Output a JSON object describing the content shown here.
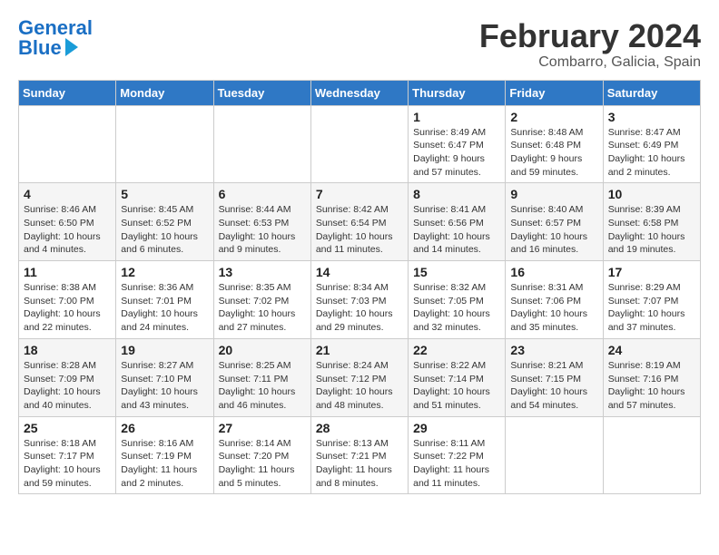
{
  "header": {
    "logo_general": "General",
    "logo_blue": "Blue",
    "month": "February 2024",
    "location": "Combarro, Galicia, Spain"
  },
  "weekdays": [
    "Sunday",
    "Monday",
    "Tuesday",
    "Wednesday",
    "Thursday",
    "Friday",
    "Saturday"
  ],
  "weeks": [
    [
      {
        "day": "",
        "info": ""
      },
      {
        "day": "",
        "info": ""
      },
      {
        "day": "",
        "info": ""
      },
      {
        "day": "",
        "info": ""
      },
      {
        "day": "1",
        "info": "Sunrise: 8:49 AM\nSunset: 6:47 PM\nDaylight: 9 hours\nand 57 minutes."
      },
      {
        "day": "2",
        "info": "Sunrise: 8:48 AM\nSunset: 6:48 PM\nDaylight: 9 hours\nand 59 minutes."
      },
      {
        "day": "3",
        "info": "Sunrise: 8:47 AM\nSunset: 6:49 PM\nDaylight: 10 hours\nand 2 minutes."
      }
    ],
    [
      {
        "day": "4",
        "info": "Sunrise: 8:46 AM\nSunset: 6:50 PM\nDaylight: 10 hours\nand 4 minutes."
      },
      {
        "day": "5",
        "info": "Sunrise: 8:45 AM\nSunset: 6:52 PM\nDaylight: 10 hours\nand 6 minutes."
      },
      {
        "day": "6",
        "info": "Sunrise: 8:44 AM\nSunset: 6:53 PM\nDaylight: 10 hours\nand 9 minutes."
      },
      {
        "day": "7",
        "info": "Sunrise: 8:42 AM\nSunset: 6:54 PM\nDaylight: 10 hours\nand 11 minutes."
      },
      {
        "day": "8",
        "info": "Sunrise: 8:41 AM\nSunset: 6:56 PM\nDaylight: 10 hours\nand 14 minutes."
      },
      {
        "day": "9",
        "info": "Sunrise: 8:40 AM\nSunset: 6:57 PM\nDaylight: 10 hours\nand 16 minutes."
      },
      {
        "day": "10",
        "info": "Sunrise: 8:39 AM\nSunset: 6:58 PM\nDaylight: 10 hours\nand 19 minutes."
      }
    ],
    [
      {
        "day": "11",
        "info": "Sunrise: 8:38 AM\nSunset: 7:00 PM\nDaylight: 10 hours\nand 22 minutes."
      },
      {
        "day": "12",
        "info": "Sunrise: 8:36 AM\nSunset: 7:01 PM\nDaylight: 10 hours\nand 24 minutes."
      },
      {
        "day": "13",
        "info": "Sunrise: 8:35 AM\nSunset: 7:02 PM\nDaylight: 10 hours\nand 27 minutes."
      },
      {
        "day": "14",
        "info": "Sunrise: 8:34 AM\nSunset: 7:03 PM\nDaylight: 10 hours\nand 29 minutes."
      },
      {
        "day": "15",
        "info": "Sunrise: 8:32 AM\nSunset: 7:05 PM\nDaylight: 10 hours\nand 32 minutes."
      },
      {
        "day": "16",
        "info": "Sunrise: 8:31 AM\nSunset: 7:06 PM\nDaylight: 10 hours\nand 35 minutes."
      },
      {
        "day": "17",
        "info": "Sunrise: 8:29 AM\nSunset: 7:07 PM\nDaylight: 10 hours\nand 37 minutes."
      }
    ],
    [
      {
        "day": "18",
        "info": "Sunrise: 8:28 AM\nSunset: 7:09 PM\nDaylight: 10 hours\nand 40 minutes."
      },
      {
        "day": "19",
        "info": "Sunrise: 8:27 AM\nSunset: 7:10 PM\nDaylight: 10 hours\nand 43 minutes."
      },
      {
        "day": "20",
        "info": "Sunrise: 8:25 AM\nSunset: 7:11 PM\nDaylight: 10 hours\nand 46 minutes."
      },
      {
        "day": "21",
        "info": "Sunrise: 8:24 AM\nSunset: 7:12 PM\nDaylight: 10 hours\nand 48 minutes."
      },
      {
        "day": "22",
        "info": "Sunrise: 8:22 AM\nSunset: 7:14 PM\nDaylight: 10 hours\nand 51 minutes."
      },
      {
        "day": "23",
        "info": "Sunrise: 8:21 AM\nSunset: 7:15 PM\nDaylight: 10 hours\nand 54 minutes."
      },
      {
        "day": "24",
        "info": "Sunrise: 8:19 AM\nSunset: 7:16 PM\nDaylight: 10 hours\nand 57 minutes."
      }
    ],
    [
      {
        "day": "25",
        "info": "Sunrise: 8:18 AM\nSunset: 7:17 PM\nDaylight: 10 hours\nand 59 minutes."
      },
      {
        "day": "26",
        "info": "Sunrise: 8:16 AM\nSunset: 7:19 PM\nDaylight: 11 hours\nand 2 minutes."
      },
      {
        "day": "27",
        "info": "Sunrise: 8:14 AM\nSunset: 7:20 PM\nDaylight: 11 hours\nand 5 minutes."
      },
      {
        "day": "28",
        "info": "Sunrise: 8:13 AM\nSunset: 7:21 PM\nDaylight: 11 hours\nand 8 minutes."
      },
      {
        "day": "29",
        "info": "Sunrise: 8:11 AM\nSunset: 7:22 PM\nDaylight: 11 hours\nand 11 minutes."
      },
      {
        "day": "",
        "info": ""
      },
      {
        "day": "",
        "info": ""
      }
    ]
  ]
}
